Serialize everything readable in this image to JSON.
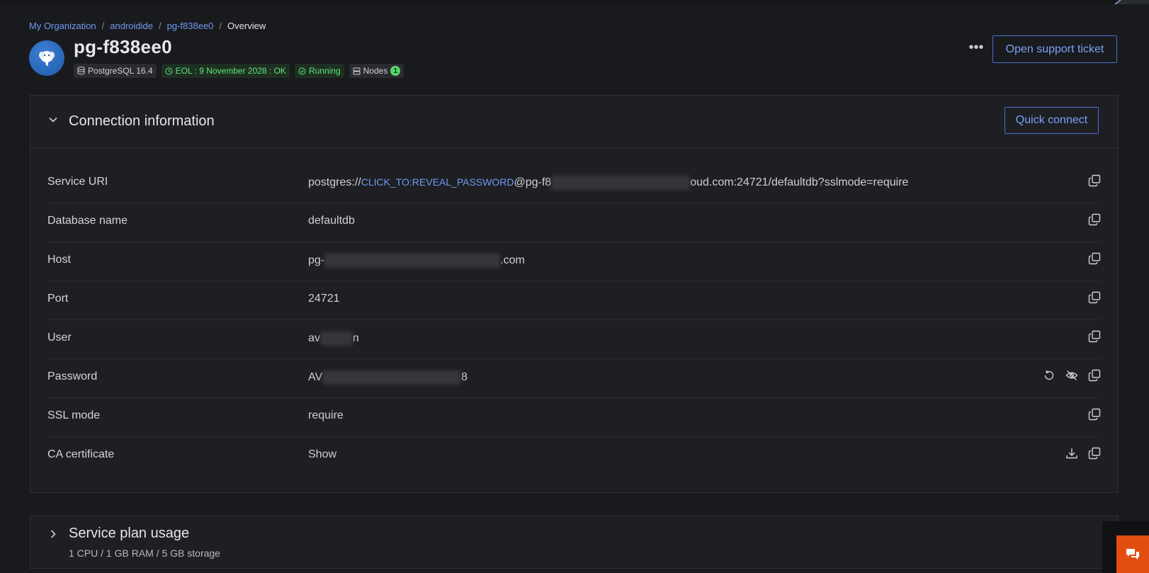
{
  "breadcrumb": {
    "org": "My Organization",
    "project": "androidide",
    "service": "pg-f838ee0",
    "current": "Overview",
    "separator": "/"
  },
  "service": {
    "name": "pg-f838ee0",
    "tags": {
      "engine": "PostgreSQL 16.4",
      "eol": "EOL : 9 November 2028 : OK",
      "status": "Running",
      "nodes_label": "Nodes",
      "nodes_count": "1"
    }
  },
  "header_actions": {
    "more": "•••",
    "support_ticket": "Open support ticket"
  },
  "connection": {
    "title": "Connection information",
    "quick_connect": "Quick connect",
    "rows": [
      {
        "label": "Service URI",
        "value_prefix": "postgres://",
        "value_link": "CLICK_TO:REVEAL_PASSWORD",
        "value_mid": "@pg-f8",
        "value_suffix": "oud.com:24721/defaultdb?sslmode=require"
      },
      {
        "label": "Database name",
        "value": "defaultdb"
      },
      {
        "label": "Host",
        "value_prefix": "pg-",
        "value_suffix": ".com"
      },
      {
        "label": "Port",
        "value": "24721"
      },
      {
        "label": "User",
        "value_prefix": "av",
        "value_suffix": "n"
      },
      {
        "label": "Password",
        "value_prefix": "AV",
        "value_suffix": "8"
      },
      {
        "label": "SSL mode",
        "value": "require"
      },
      {
        "label": "CA certificate",
        "value_link": "Show"
      }
    ]
  },
  "plan": {
    "title": "Service plan usage",
    "summary": "1 CPU / 1 GB RAM / 5 GB storage"
  },
  "colors": {
    "accent": "#6f9af2",
    "status_green": "#5ee67b",
    "chat": "#e24e0f"
  },
  "icons": {
    "copy": "copy-icon",
    "refresh": "refresh-icon",
    "eye_off": "eye-off-icon",
    "download": "download-icon",
    "chat": "chat-icon"
  }
}
